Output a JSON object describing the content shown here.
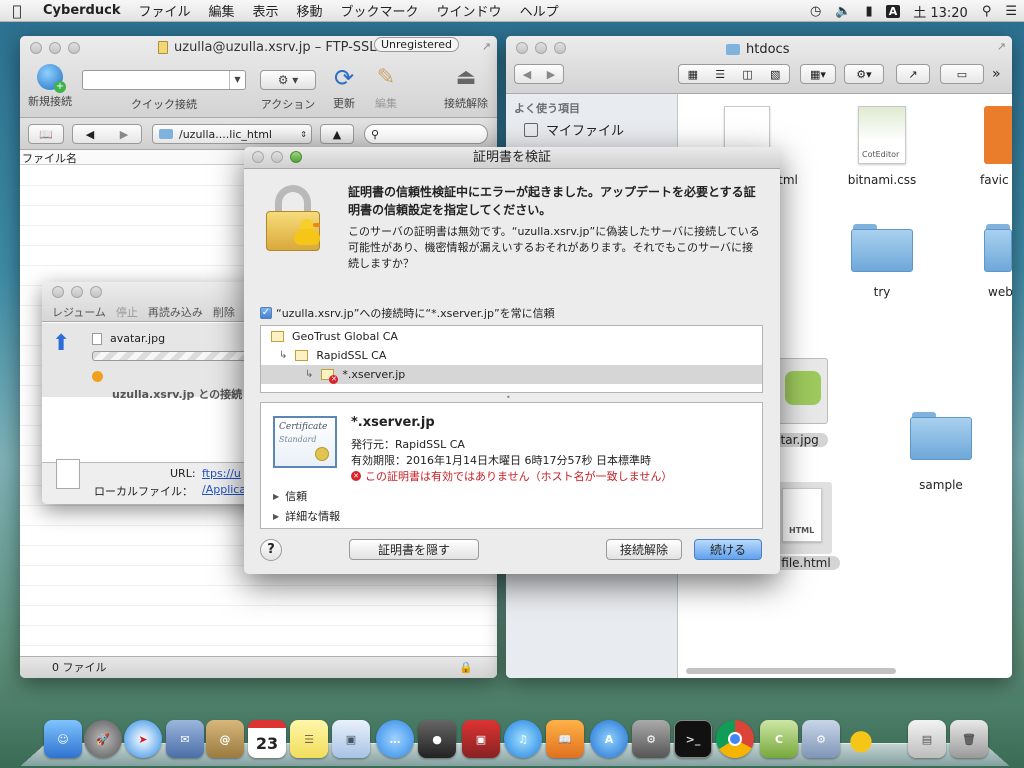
{
  "menubar": {
    "app": "Cyberduck",
    "items": [
      "ファイル",
      "編集",
      "表示",
      "移動",
      "ブックマーク",
      "ウインドウ",
      "ヘルプ"
    ],
    "input_indicator": "A",
    "clock": "土 13:20"
  },
  "cyberduck": {
    "title": "uzulla@uzulla.xsrv.jp – FTP-SSL",
    "badge": "Unregistered",
    "toolbar": {
      "new_connection": "新規接続",
      "quick_connect": "クイック接続",
      "action": "アクション",
      "refresh": "更新",
      "edit": "編集",
      "disconnect": "接続解除"
    },
    "path": "/uzulla....lic_html",
    "column_filename": "ファイル名",
    "status": "0 ファイル"
  },
  "transfers": {
    "actions": [
      "レジューム",
      "停止",
      "再読み込み",
      "削除"
    ],
    "file": "avatar.jpg",
    "status_text": "uzulla.xsrv.jp との接続",
    "url_label": "URL:",
    "url_value": "ftps://u",
    "local_label": "ローカルファイル：",
    "local_value": "/Applica"
  },
  "finder": {
    "title": "htdocs",
    "sidebar_header": "よく使う項目",
    "sidebar_items": [
      "マイファイル"
    ],
    "items": [
      {
        "label": "bitnami.css",
        "kind": "css",
        "badge": "CotEditor"
      },
      {
        "label": "favic",
        "kind": "icon"
      },
      {
        "label": "try",
        "kind": "folder"
      },
      {
        "label": "web",
        "kind": "folder"
      },
      {
        "label": "sample",
        "kind": "folder"
      },
      {
        "label": "tml",
        "kind": "html"
      },
      {
        "label": "atar.jpg",
        "kind": "image"
      },
      {
        "label": "file.html",
        "kind": "html",
        "badge": "HTML"
      }
    ]
  },
  "dialog": {
    "title": "証明書を検証",
    "message_bold": "証明書の信頼性検証中にエラーが起きました。アップデートを必要とする証明書の信頼設定を指定してください。",
    "message": "このサーバの証明書は無効です。“uzulla.xsrv.jp”に偽装したサーバに接続している可能性があり、機密情報が漏えいするおそれがあります。それでもこのサーバに接続しますか？",
    "always_trust": "“uzulla.xsrv.jp”への接続時に“*.xserver.jp”を常に信頼",
    "always_trust_checked": true,
    "chain": [
      "GeoTrust Global CA",
      "RapidSSL CA",
      "*.xserver.jp"
    ],
    "cert_image_text": [
      "Certificate",
      "Standard"
    ],
    "cert_name": "*.xserver.jp",
    "issuer": "発行元：RapidSSL CA",
    "expires": "有効期限：2016年1月14日木曜日 6時17分57秒 日本標準時",
    "error": "この証明書は有効ではありません（ホスト名が一致しません）",
    "trust_label": "信頼",
    "details_label": "詳細な情報",
    "btn_hide": "証明書を隠す",
    "btn_disconnect": "接続解除",
    "btn_continue": "続ける",
    "help": "?"
  },
  "dock": {
    "calendar_day": "23",
    "apps": [
      "Finder",
      "Launchpad",
      "Safari",
      "Mail",
      "Contacts",
      "Calendar",
      "Notes",
      "Preview",
      "Messages",
      "FaceTime",
      "Photo Booth",
      "iTunes",
      "iBooks",
      "App Store",
      "System Preferences",
      "Terminal",
      "Chrome",
      "CotEditor",
      "Utility",
      "Cyberduck",
      "Downloads",
      "Trash"
    ]
  }
}
